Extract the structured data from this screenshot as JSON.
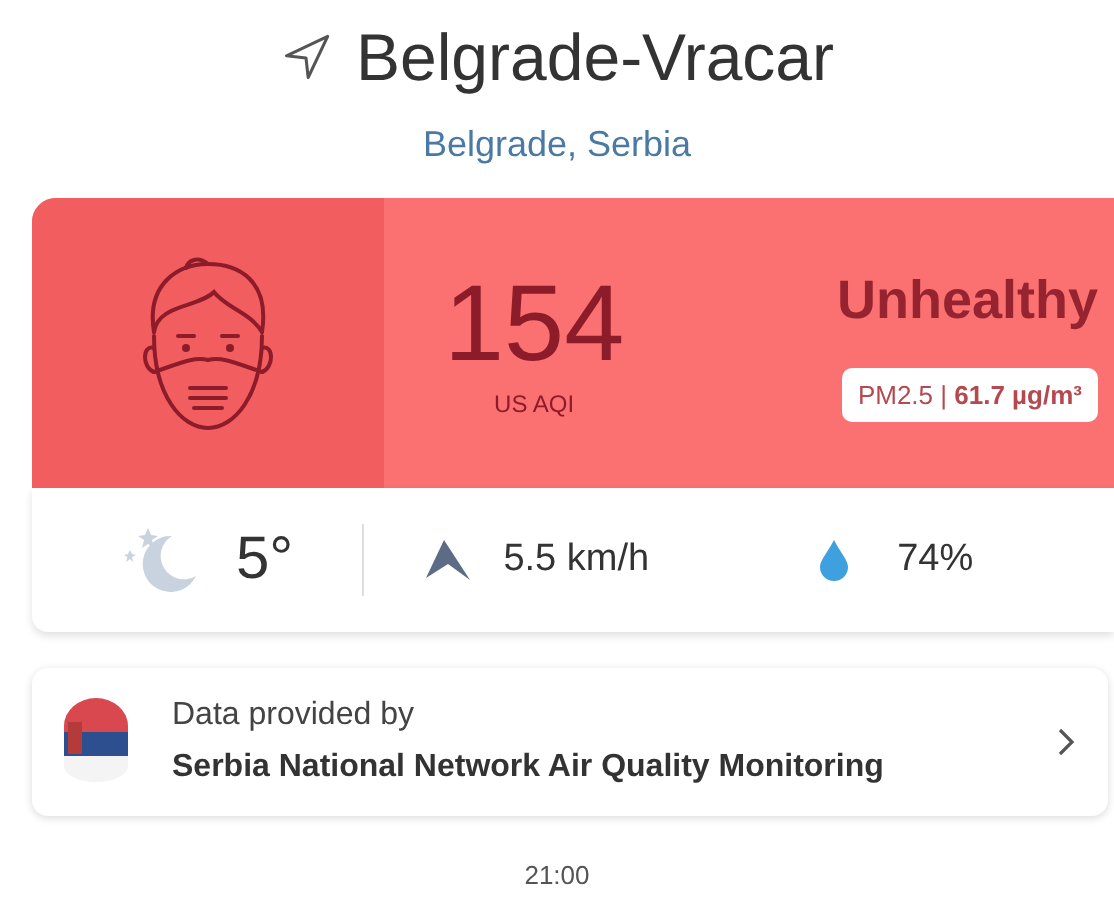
{
  "location": {
    "title": "Belgrade-Vracar",
    "subtitle": "Belgrade, Serbia"
  },
  "aqi": {
    "value": "154",
    "unit": "US AQI",
    "status": "Unhealthy",
    "pollutant": "PM2.5 | **61.7 µg/m³**"
  },
  "weather": [
    {
      "kind": "temperature",
      "text": "5°"
    },
    {
      "kind": "wind",
      "text": "5.5 km/h"
    },
    {
      "kind": "humidity",
      "text": "74%"
    }
  ],
  "source": {
    "label": "Data provided by",
    "name": "Serbia National Network Air Quality Monitoring"
  },
  "time": "21:00"
}
